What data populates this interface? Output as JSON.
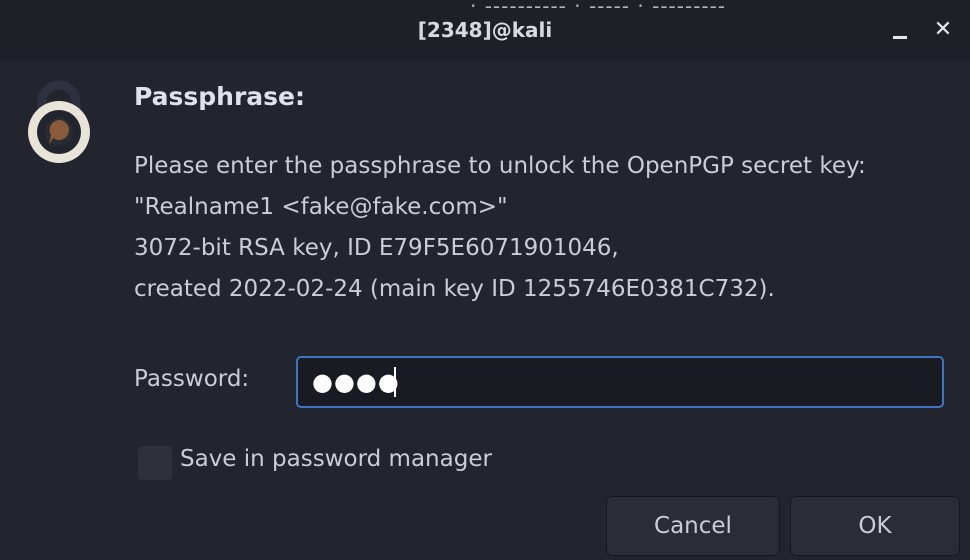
{
  "window": {
    "title": "[2348]@kali",
    "background_peek": "· ----------  · -----  · ---------",
    "minimize_label": "_",
    "close_label": "✕"
  },
  "dialog": {
    "heading": "Passphrase:",
    "description_lines": [
      "Please enter the passphrase to unlock the OpenPGP secret key:",
      "\"Realname1 <fake@fake.com>\"",
      "3072-bit RSA key, ID E79F5E6071901046,",
      "created 2022-02-24 (main key ID 1255746E0381C732)."
    ],
    "password_label": "Password:",
    "password_masked": "●●●●",
    "save_label": "Save in password manager",
    "cancel_label": "Cancel",
    "ok_label": "OK"
  },
  "colors": {
    "background": "#23252e",
    "titlebar": "#1e2028",
    "accent_border": "#3f74c5",
    "text": "#c9cdd6"
  },
  "icons": {
    "lock": "padlock-icon"
  }
}
